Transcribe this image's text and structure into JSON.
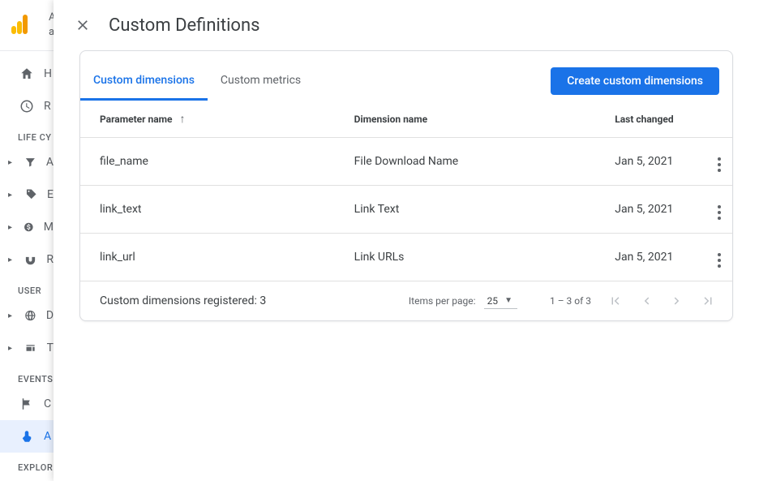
{
  "sidebar": {
    "top_letter_a": "A",
    "top_letter_b": "a",
    "items_primary": [
      "H",
      "R"
    ],
    "section_life_cycle": "LIFE CY",
    "items_life_cycle": [
      "A",
      "E",
      "M",
      "R"
    ],
    "section_user": "USER",
    "items_user": [
      "D",
      "T"
    ],
    "section_events": "EVENTS",
    "items_events": [
      "C",
      "A"
    ],
    "section_explore": "EXPLOR"
  },
  "panel": {
    "title": "Custom Definitions",
    "tabs": {
      "dimensions": "Custom dimensions",
      "metrics": "Custom metrics"
    },
    "create_button": "Create custom dimensions",
    "columns": {
      "parameter": "Parameter name",
      "dimension": "Dimension name",
      "last_changed": "Last changed"
    },
    "rows": [
      {
        "param": "file_name",
        "dim": "File Download Name",
        "date": "Jan 5, 2021"
      },
      {
        "param": "link_text",
        "dim": "Link Text",
        "date": "Jan 5, 2021"
      },
      {
        "param": "link_url",
        "dim": "Link URLs",
        "date": "Jan 5, 2021"
      }
    ],
    "registered": "Custom dimensions registered: 3",
    "pagination": {
      "items_per_page_label": "Items per page:",
      "page_size": "25",
      "range": "1 – 3 of 3"
    }
  }
}
